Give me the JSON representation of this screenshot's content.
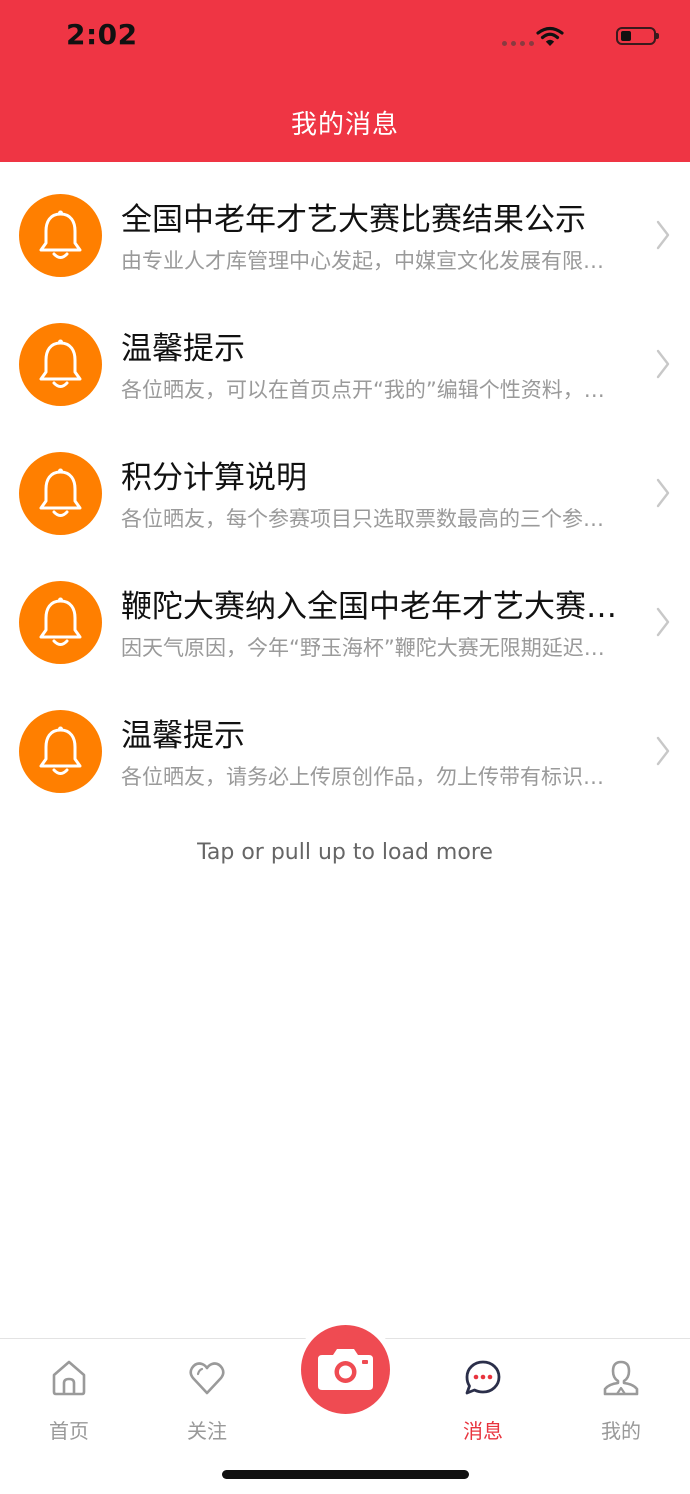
{
  "status_bar": {
    "time": "2:02"
  },
  "header": {
    "title": "我的消息"
  },
  "messages": [
    {
      "title": "全国中老年才艺大赛比赛结果公示",
      "preview": "由专业人才库管理中心发起，中媒宣文化发展有限…"
    },
    {
      "title": "温馨提示",
      "preview": "各位晒友，可以在首页点开“我的”编辑个性资料，…"
    },
    {
      "title": "积分计算说明",
      "preview": "各位晒友，每个参赛项目只选取票数最高的三个参…"
    },
    {
      "title": "鞭陀大赛纳入全国中老年才艺大赛…",
      "preview": "因天气原因，今年“野玉海杯”鞭陀大赛无限期延迟…"
    },
    {
      "title": "温馨提示",
      "preview": "各位晒友，请务必上传原创作品，勿上传带有标识…"
    }
  ],
  "load_more": "Tap or pull up to load more",
  "tabs": [
    {
      "label": "首页",
      "icon": "home-icon"
    },
    {
      "label": "关注",
      "icon": "heart-icon"
    },
    {
      "label": "",
      "icon": "camera-icon"
    },
    {
      "label": "消息",
      "icon": "chat-bubble-icon",
      "active": true
    },
    {
      "label": "我的",
      "icon": "user-icon"
    }
  ],
  "colors": {
    "header": "#EF3544",
    "avatar": "#FF7F00",
    "active_tab": "#E8343E"
  }
}
